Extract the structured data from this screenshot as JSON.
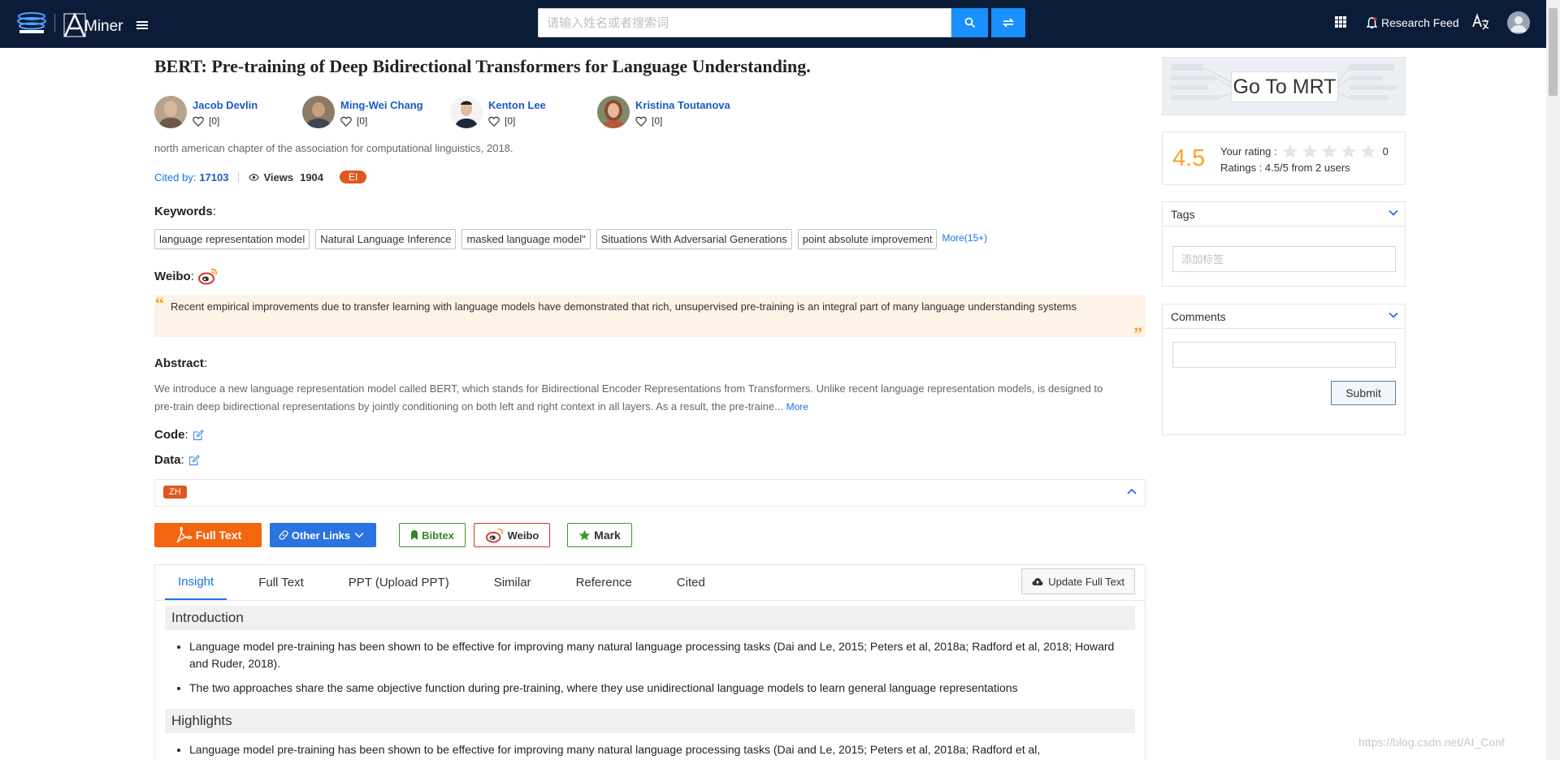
{
  "header": {
    "logo_text": "Miner",
    "search": {
      "placeholder": "请输入姓名或者搜索词",
      "value": ""
    },
    "research_feed_label": "Research Feed",
    "icons": [
      "vicvest-logo",
      "aminer-logo",
      "menu-icon",
      "search-icon",
      "swap-icon",
      "apps-grid-icon",
      "bell-icon",
      "translate-icon",
      "user-avatar-icon"
    ]
  },
  "paper": {
    "title": "BERT: Pre-training of Deep Bidirectional Transformers for Language Understanding.",
    "authors": [
      {
        "name": "Jacob Devlin",
        "follow": "[0]"
      },
      {
        "name": "Ming-Wei Chang",
        "follow": "[0]"
      },
      {
        "name": "Kenton Lee",
        "follow": "[0]"
      },
      {
        "name": "Kristina Toutanova",
        "follow": "[0]"
      }
    ],
    "venue": "north american chapter of the association for computational linguistics, 2018.",
    "cited_label": "Cited by:",
    "cited_count": "17103",
    "views_label": "Views",
    "views_count": "1904",
    "badge": "EI",
    "keywords_label": "Keywords",
    "keywords": [
      "language representation model",
      "Natural Language Inference",
      "masked language model\"",
      "Situations With Adversarial Generations",
      "point absolute improvement"
    ],
    "keywords_more": "More(15+)",
    "weibo_label": "Weibo",
    "weibo_quote": "Recent empirical improvements due to transfer learning with language models have demonstrated that rich, unsupervised pre-training is an integral part of many language understanding systems",
    "abstract_label": "Abstract",
    "abstract_text": "We introduce a new language representation model called BERT, which stands for Bidirectional Encoder Representations from Transformers. Unlike recent language representation models, is designed to pre-train deep bidirectional representations by jointly conditioning on both left and right context in all layers. As a result, the pre-traine...",
    "abstract_more": "More",
    "code_label": "Code",
    "data_label": "Data",
    "colon": ":",
    "zh_badge": "ZH"
  },
  "actions": {
    "full_text": "Full Text",
    "other_links": "Other Links",
    "bibtex": "Bibtex",
    "weibo": "Weibo",
    "mark": "Mark"
  },
  "tabs": {
    "items": [
      "Insight",
      "Full Text",
      "PPT (Upload PPT)",
      "Similar",
      "Reference",
      "Cited"
    ],
    "active": "Insight",
    "update_label": "Update Full Text"
  },
  "insight": {
    "introduction_title": "Introduction",
    "introduction": [
      "Language model pre-training has been shown to be effective for improving many natural language processing tasks (Dai and Le, 2015; Peters et al, 2018a; Radford et al, 2018; Howard and Ruder, 2018).",
      "The two approaches share the same objective function during pre-training, where they use unidirectional language models to learn general language representations"
    ],
    "highlights_title": "Highlights",
    "highlights": [
      "Language model pre-training has been shown to be effective for improving many natural language processing tasks (Dai and Le, 2015; Peters et al, 2018a; Radford et al,"
    ]
  },
  "sidebar": {
    "mrt_label": "Go To MRT",
    "rating_score": "4.5",
    "your_rating_label": "Your rating :",
    "your_rating_value": 0,
    "your_rating_text": "0",
    "rating_summary": "Ratings : 4.5/5 from 2 users",
    "tags_title": "Tags",
    "tags_placeholder": "添加标签",
    "comments_title": "Comments",
    "comment_value": "",
    "submit_label": "Submit"
  },
  "watermark": "https://blog.csdn.net/AI_Conf",
  "colors": {
    "nav_bg": "#0b1c39",
    "primary_blue": "#1890ff",
    "full_text_orange": "#f3650e",
    "ei_orange": "#e0581e",
    "rating_gold": "#f5a623",
    "bibtex_green": "#3a9a2a",
    "weibo_red": "#d0342c",
    "quote_bg": "#fdf3e6"
  }
}
